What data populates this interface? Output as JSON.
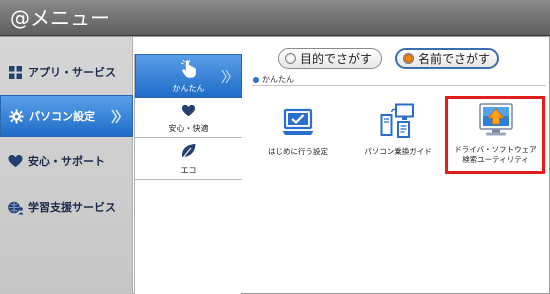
{
  "window": {
    "title": "@メニュー"
  },
  "left_menu": {
    "items": [
      {
        "label": "アプリ・サービス",
        "icon": "apps-grid-icon",
        "active": false
      },
      {
        "label": "パソコン設定",
        "icon": "gear-icon",
        "active": true
      },
      {
        "label": "安心・サポート",
        "icon": "heart-icon",
        "active": false
      },
      {
        "label": "学習支援サービス",
        "icon": "globe-person-icon",
        "active": false
      }
    ]
  },
  "sub_menu": {
    "items": [
      {
        "label": "かんたん",
        "icon": "hand-pointer-icon",
        "active": true
      },
      {
        "label": "安心・快適",
        "icon": "heart-icon",
        "active": false
      },
      {
        "label": "エコ",
        "icon": "leaf-icon",
        "active": false
      }
    ]
  },
  "search_mode": {
    "options": [
      {
        "label": "目的でさがす",
        "selected": false
      },
      {
        "label": "名前でさがす",
        "selected": true
      }
    ]
  },
  "section": {
    "label": "かんたん"
  },
  "tiles": [
    {
      "label": "はじめに行う設定",
      "icon": "laptop-check-icon",
      "highlighted": false
    },
    {
      "label": "パソコン乗換ガイド",
      "icon": "pc-transfer-icon",
      "highlighted": false
    },
    {
      "label": "ドライバ・ソフトウェア\n検索ユーティリティ",
      "icon": "driver-search-icon",
      "highlighted": true
    }
  ],
  "colors": {
    "accent_blue": "#1f6cc8",
    "highlight_red": "#e21d1d",
    "radio_on": "#ff8a00"
  }
}
